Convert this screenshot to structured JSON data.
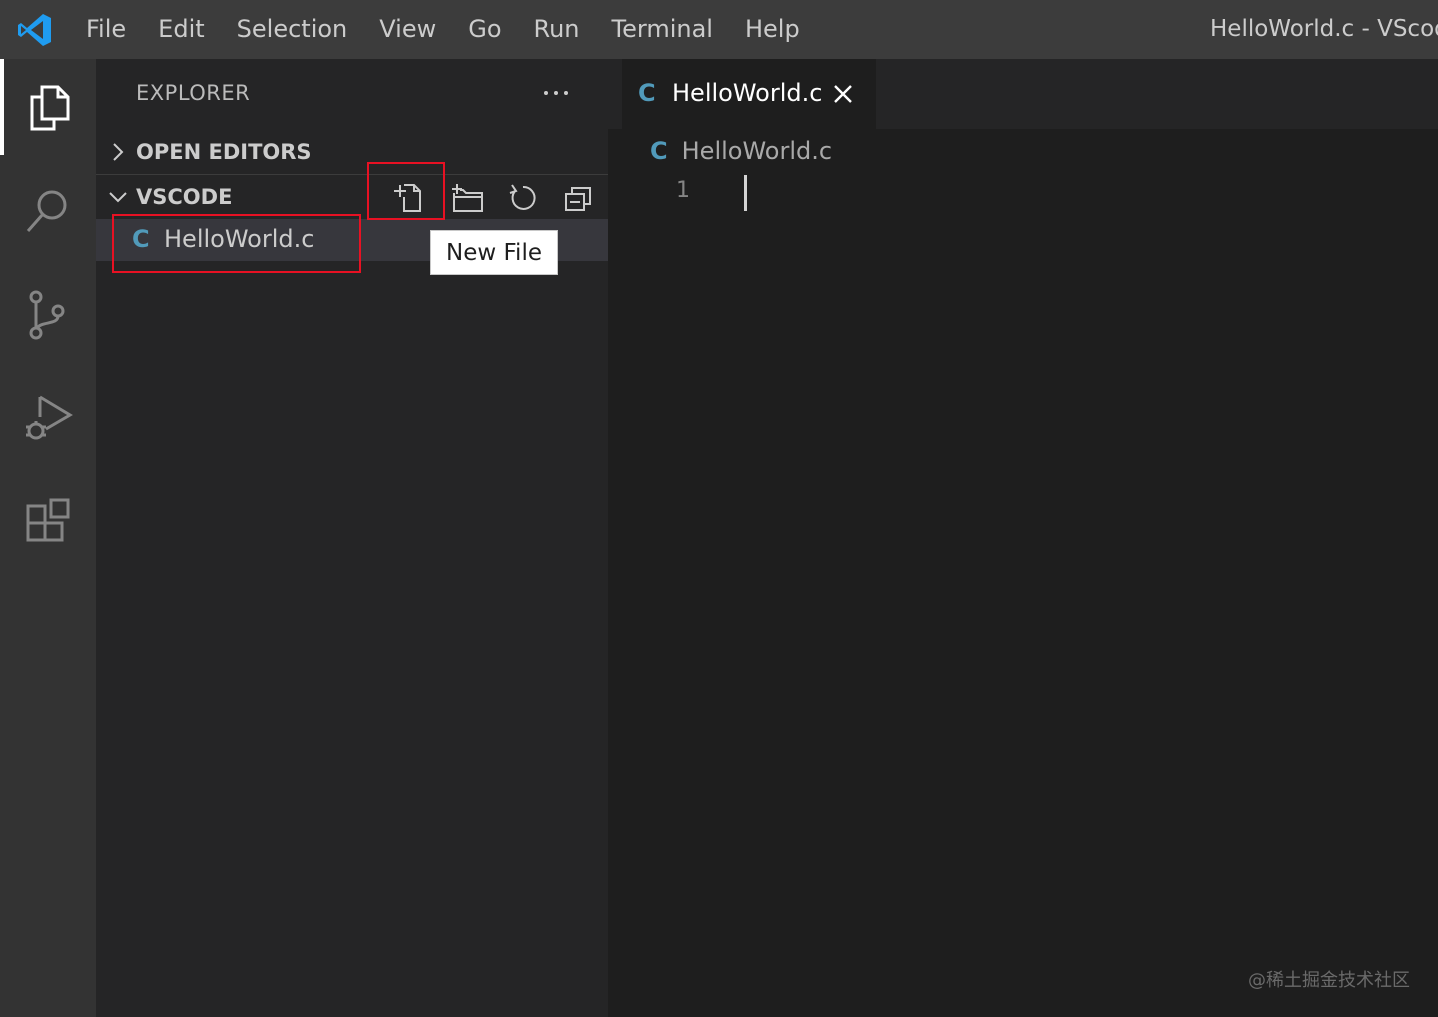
{
  "menu": [
    "File",
    "Edit",
    "Selection",
    "View",
    "Go",
    "Run",
    "Terminal",
    "Help"
  ],
  "window_title": "HelloWorld.c - VScode",
  "colors": {
    "titlebar": "#3c3c3c",
    "activitybar": "#333333",
    "sidebar": "#252526",
    "editor": "#1e1e1e",
    "c_file_icon": "#519aba",
    "highlight_box": "#e81123"
  },
  "activity_bar": {
    "items": [
      {
        "name": "explorer",
        "icon": "files-icon",
        "active": true
      },
      {
        "name": "search",
        "icon": "search-icon",
        "active": false
      },
      {
        "name": "source-control",
        "icon": "source-control-icon",
        "active": false
      },
      {
        "name": "run-debug",
        "icon": "run-debug-icon",
        "active": false
      },
      {
        "name": "extensions",
        "icon": "extensions-icon",
        "active": false
      }
    ]
  },
  "sidebar": {
    "title": "EXPLORER",
    "more_actions_label": "···",
    "open_editors_label": "OPEN EDITORS",
    "folder_label": "VSCODE",
    "folder_actions": [
      "new-file-icon",
      "new-folder-icon",
      "refresh-icon",
      "collapse-all-icon"
    ],
    "files": [
      {
        "icon": "C",
        "name": "HelloWorld.c"
      }
    ]
  },
  "tooltip": {
    "text": "New File"
  },
  "editor": {
    "tab": {
      "icon": "C",
      "name": "HelloWorld.c"
    },
    "breadcrumb": {
      "icon": "C",
      "name": "HelloWorld.c"
    },
    "line_numbers": [
      "1"
    ]
  },
  "watermark": "@稀土掘金技术社区"
}
